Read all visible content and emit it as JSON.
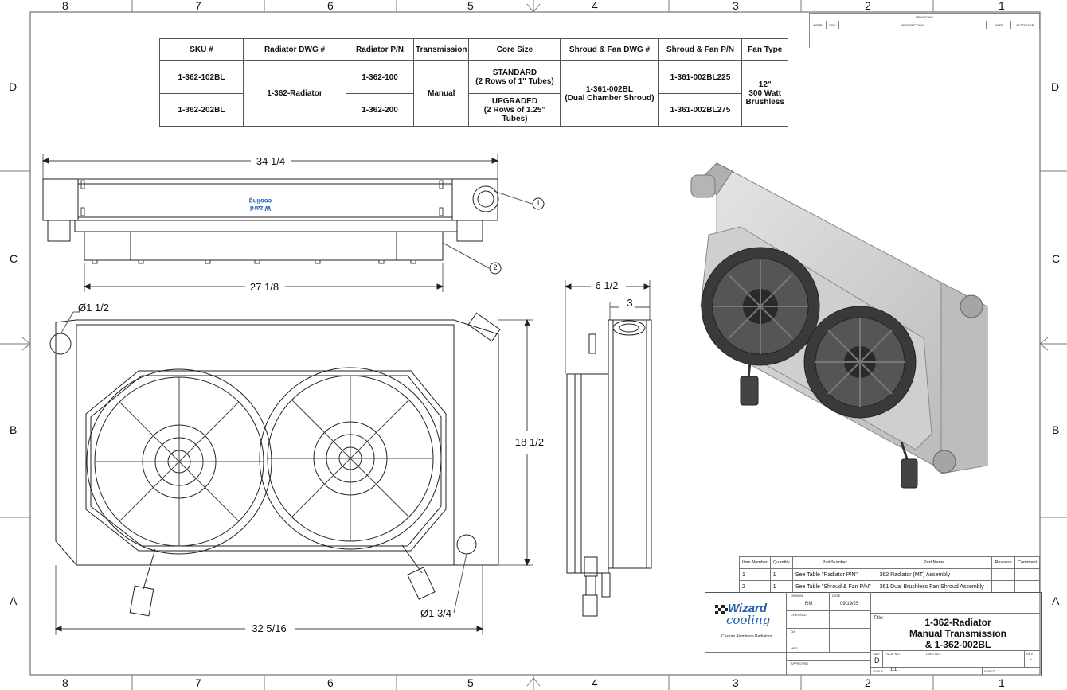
{
  "border": {
    "columns": [
      "8",
      "7",
      "6",
      "5",
      "4",
      "3",
      "2",
      "1"
    ],
    "rows": [
      "D",
      "C",
      "B",
      "A"
    ]
  },
  "revisions": {
    "title": "REVISIONS",
    "headers": [
      "ZONE",
      "REV",
      "DESCRIPTION",
      "DATE",
      "APPROVED"
    ]
  },
  "spec_table": {
    "headers": [
      "SKU #",
      "Radiator DWG #",
      "Radiator P/N",
      "Transmission",
      "Core Size",
      "Shroud & Fan DWG #",
      "Shroud & Fan P/N",
      "Fan Type"
    ],
    "sku": [
      "1-362-102BL",
      "1-362-202BL"
    ],
    "radiator_dwg": "1-362-Radiator",
    "radiator_pn": [
      "1-362-100",
      "1-362-200"
    ],
    "transmission": "Manual",
    "core_size": [
      {
        "name": "STANDARD",
        "detail": "(2 Rows of 1\" Tubes)"
      },
      {
        "name": "UPGRADED",
        "detail": "(2 Rows of 1.25\" Tubes)"
      }
    ],
    "shroud_dwg": {
      "number": "1-361-002BL",
      "detail": "(Dual Chamber Shroud)"
    },
    "shroud_pn": [
      "1-361-002BL225",
      "1-361-002BL275"
    ],
    "fan_type": [
      "12\"",
      "300 Watt",
      "Brushless"
    ]
  },
  "dimensions": {
    "top_width": "34 1/4",
    "core_width": "27 1/8",
    "front_width": "32 5/16",
    "height": "18 1/2",
    "depth": "6 1/2",
    "depth_tank": "3",
    "inlet_dia": "Ø1 1/2",
    "outlet_dia": "Ø1 3/4"
  },
  "balloons": [
    "1",
    "2"
  ],
  "logo": {
    "top": "Wizard",
    "bottom": "cooling",
    "tagline": "Custom Aluminum Radiators"
  },
  "bom": {
    "headers": [
      "Item Number",
      "Quantity",
      "Part Number",
      "Part Name",
      "Revision",
      "Comment"
    ],
    "rows": [
      {
        "item": "1",
        "qty": "1",
        "part_number": "See Table \"Radiator P/N\"",
        "part_name": "362 Radiator (MT) Assembly"
      },
      {
        "item": "2",
        "qty": "1",
        "part_number": "See Table \"Shroud & Fan P/N\"",
        "part_name": "361 Dual Brushless Fan Shroud Assembly"
      }
    ]
  },
  "title_block": {
    "drawn_label": "DRAWN",
    "drawn_by": "RM",
    "date_label": "DATE",
    "date": "09/19/25",
    "checked_label": "CHECKED",
    "qa_label": "QA",
    "mfg_label": "MFG",
    "approved_label": "APPROVED",
    "title_label": "Title:",
    "title": [
      "1-362-Radiator",
      "Manual Transmission",
      "& 1-362-002BL"
    ],
    "size_label": "SIZE",
    "size": "D",
    "fscm_label": "FSCM NO.",
    "dwg_label": "DWG NO.",
    "rev_label": "REV",
    "rev": "-",
    "scale_label": "SCALE",
    "scale": "1:1",
    "sheet_label": "SHEET"
  },
  "colors": {
    "line": "#222222",
    "logo_blue": "#1f5faa",
    "render_gray": "#c9c9c9"
  }
}
